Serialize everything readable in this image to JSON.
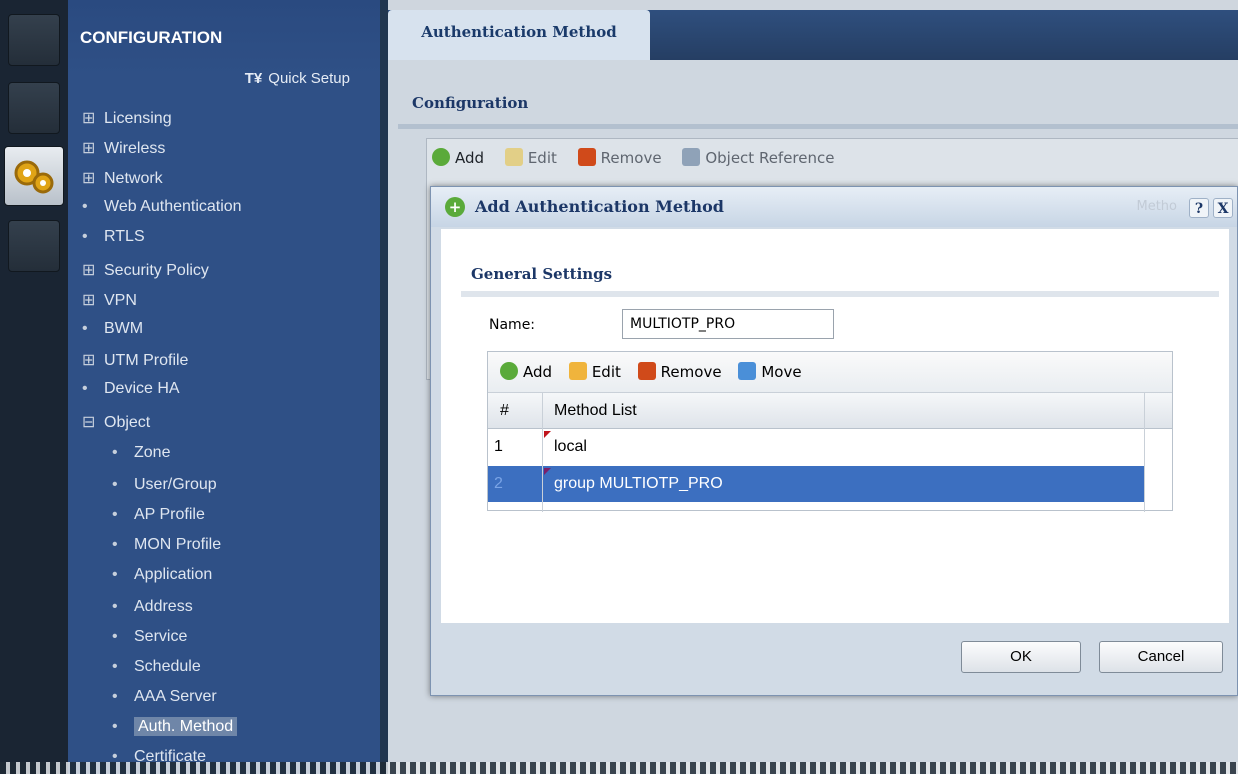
{
  "sidebar": {
    "title": "CONFIGURATION",
    "quick_setup": "Quick Setup",
    "items": [
      {
        "marker": "⊞",
        "label": "Licensing"
      },
      {
        "marker": "⊞",
        "label": "Wireless"
      },
      {
        "marker": "⊞",
        "label": "Network"
      },
      {
        "marker": "•",
        "label": "Web Authentication"
      },
      {
        "marker": "•",
        "label": "RTLS"
      },
      {
        "marker": "⊞",
        "label": "Security Policy"
      },
      {
        "marker": "⊞",
        "label": "VPN"
      },
      {
        "marker": "•",
        "label": "BWM"
      },
      {
        "marker": "⊞",
        "label": "UTM Profile"
      },
      {
        "marker": "•",
        "label": "Device HA"
      },
      {
        "marker": "⊟",
        "label": "Object"
      },
      {
        "marker": "•",
        "label": "Zone"
      },
      {
        "marker": "•",
        "label": "User/Group"
      },
      {
        "marker": "•",
        "label": "AP Profile"
      },
      {
        "marker": "•",
        "label": "MON Profile"
      },
      {
        "marker": "•",
        "label": "Application"
      },
      {
        "marker": "•",
        "label": "Address"
      },
      {
        "marker": "•",
        "label": "Service"
      },
      {
        "marker": "•",
        "label": "Schedule"
      },
      {
        "marker": "•",
        "label": "AAA Server"
      },
      {
        "marker": "•",
        "label": "Auth. Method"
      },
      {
        "marker": "•",
        "label": "Certificate"
      }
    ]
  },
  "tab": {
    "label": "Authentication Method"
  },
  "config": {
    "title": "Configuration",
    "toolbar": {
      "add": "Add",
      "edit": "Edit",
      "remove": "Remove",
      "object_reference": "Object Reference"
    }
  },
  "dialog": {
    "title": "Add Authentication Method",
    "ghost_header": "Metho",
    "help": "?",
    "close": "X",
    "section": "General Settings",
    "name_label": "Name:",
    "name_value": "MULTIOTP_PRO",
    "grid_toolbar": {
      "add": "Add",
      "edit": "Edit",
      "remove": "Remove",
      "move": "Move"
    },
    "columns": {
      "index": "#",
      "method": "Method List"
    },
    "rows": [
      {
        "index": "1",
        "method": "local"
      },
      {
        "index": "2",
        "method": "group MULTIOTP_PRO"
      }
    ],
    "ok": "OK",
    "cancel": "Cancel"
  },
  "colors": {
    "sidebar": "#2f5086",
    "selection": "#3c6fc0",
    "add_green": "#5aaa3a",
    "remove_red": "#d04a1a"
  }
}
